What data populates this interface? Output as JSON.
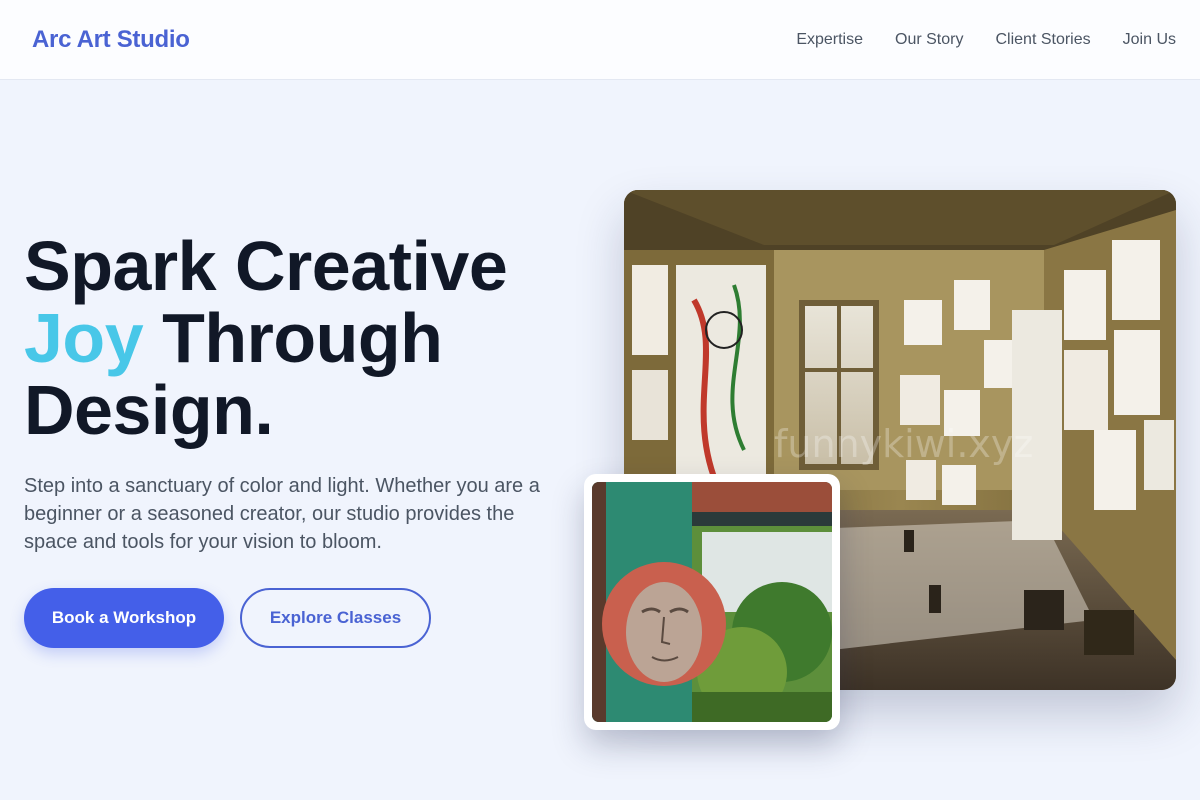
{
  "brand": {
    "name": "Arc Art Studio"
  },
  "nav": {
    "links": [
      "Expertise",
      "Our Story",
      "Client Stories",
      "Join Us"
    ]
  },
  "hero": {
    "headline_line1": "Spark Creative",
    "headline_accent": "Joy",
    "headline_line2_rest": " Through",
    "headline_line3": "Design.",
    "description": "Step into a sanctuary of color and light. Whether you are a beginner or a seasoned creator, our studio provides the space and tools for your vision to bloom.",
    "primary_cta": "Book a Workshop",
    "secondary_cta": "Explore Classes"
  },
  "images": {
    "main_alt": "Art studio room with drawings pinned on walls and paint supplies on the floor",
    "inset_alt": "Painted face mural on a weathered wall next to a garden window",
    "watermark": "funnykiwi.xyz"
  },
  "colors": {
    "brand": "#4a63d3",
    "accent": "#48c7e8",
    "primary_button": "#445fe9",
    "background": "#f0f4fd",
    "headline": "#111827"
  }
}
